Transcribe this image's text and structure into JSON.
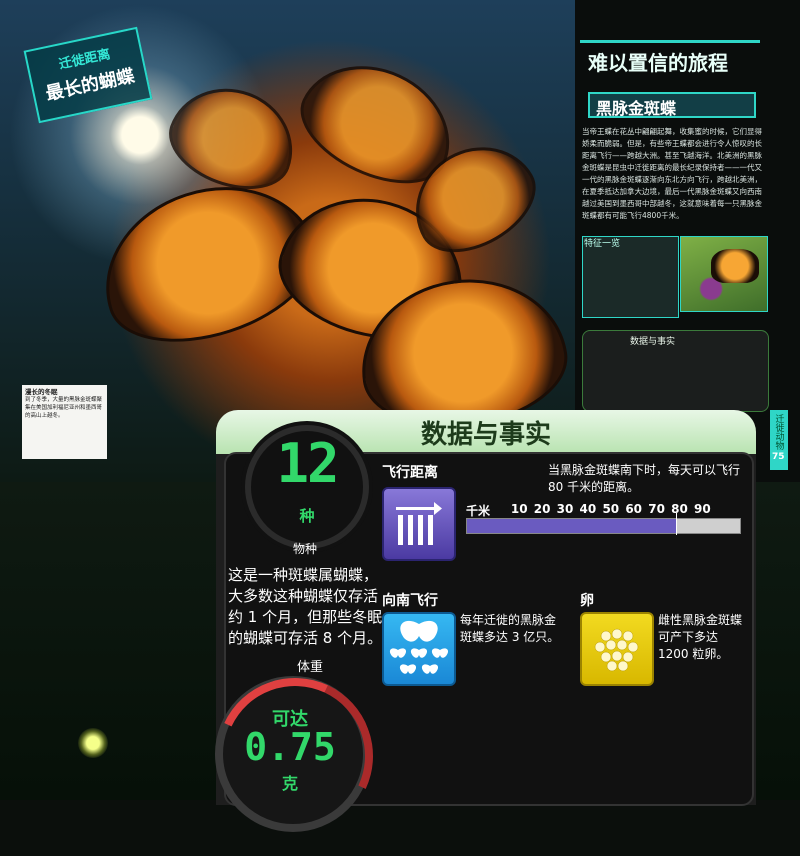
{
  "badge": {
    "line1": "迁徙距离",
    "line2": "最长的蝴蝶"
  },
  "sidebar": {
    "title": "难以置信的旅程",
    "subtitle": "黑脉金斑蝶",
    "body": "当帝王蝶在花丛中翩翩起舞，收集蜜的时候，它们显得娇柔而脆弱。但是，有些帝王蝶都会进行令人惊叹的长距离飞行——跨越大洲。甚至飞越海洋。北美洲的黑脉金斑蝶是昆虫中迁徙距离的最长纪录保持者——一代又一代的黑脉金斑蝶逐渐向东北方向飞行，跨越北美洲，在夏季抵达加拿大边境，最后一代黑脉金斑蝶又向西南越过美国到墨西哥中部越冬，这就意味着每一只黑脉金斑蝶都有可能飞行4800千米。",
    "features_title": "特征一览",
    "mini_title": "数据与事实",
    "tab_label": "迁徙动物",
    "page_number": "75"
  },
  "caption": {
    "title": "漫长的冬眠",
    "text": "到了冬季，大量的黑脉金斑蝶聚集在美国加利福尼亚州和墨西哥的高山上越冬。"
  },
  "panel": {
    "title": "数据与事实",
    "species": {
      "number": "12",
      "unit": "种",
      "label": "物种",
      "desc": "这是一种斑蝶属蝴蝶，大多数这种蝴蝶仅存活约 1 个月，但那些冬眠的蝴蝶可存活 8 个月。"
    },
    "weight": {
      "label": "体重",
      "prefix": "可达",
      "number": "0.75",
      "unit": "克"
    },
    "flight": {
      "title": "飞行距离",
      "desc": "当黑脉金斑蝶南下时，每天可以飞行 80 千米的距离。",
      "scale_unit": "千米",
      "ticks": [
        "10",
        "20",
        "30",
        "40",
        "50",
        "60",
        "70",
        "80",
        "90"
      ],
      "value_km": 80,
      "max_km": 90
    },
    "south": {
      "title": "向南飞行",
      "desc": "每年迁徙的黑脉金斑蝶多达 3 亿只。"
    },
    "eggs": {
      "title": "卵",
      "desc": "雌性黑脉金斑蝶可产下多达 1200 粒卵。"
    }
  },
  "colors": {
    "accent_green": "#32d86a",
    "accent_teal": "#2fd6c7",
    "flight_purple": "#6a5bc0",
    "south_blue": "#1a88d6",
    "egg_yellow": "#f2da20"
  }
}
